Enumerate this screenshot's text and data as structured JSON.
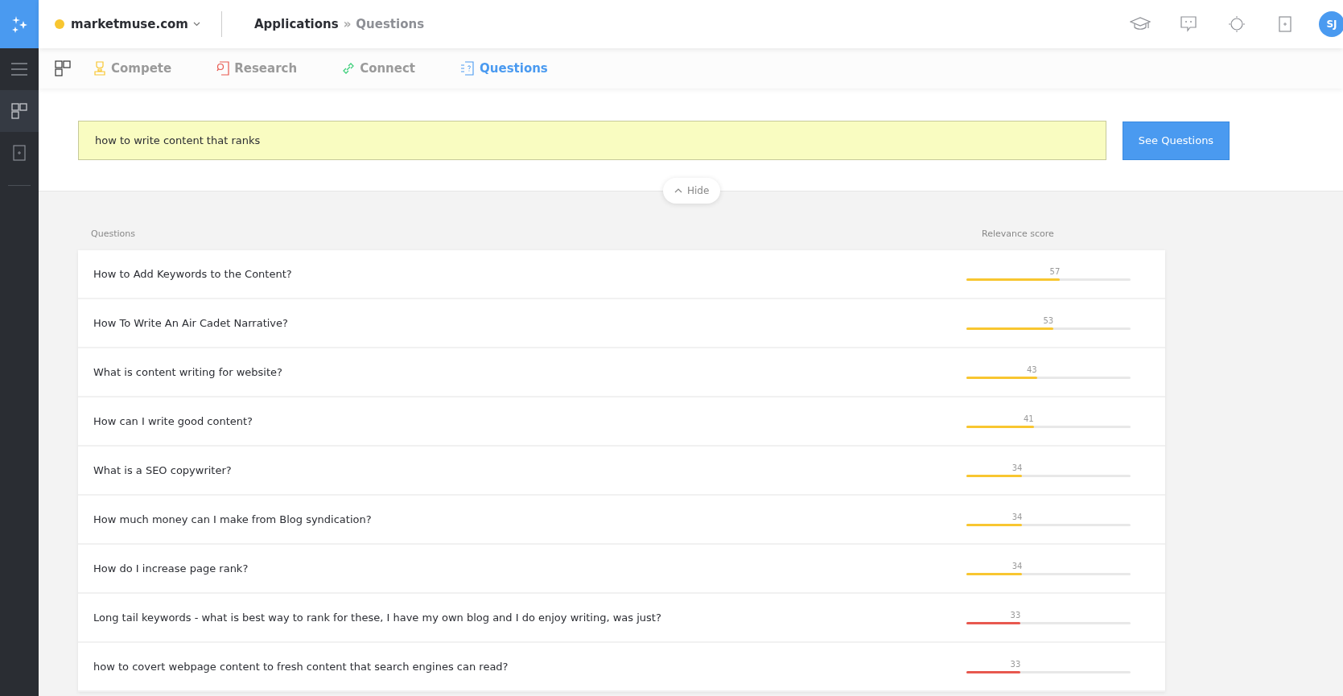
{
  "header": {
    "site": {
      "name": "marketmuse.com",
      "color": "#f8c630"
    },
    "breadcrumb": [
      "Applications",
      "Questions"
    ],
    "separator": "»",
    "avatar": "SJ"
  },
  "sidebar": {
    "items": [
      {
        "kind": "menu",
        "selected": false
      },
      {
        "kind": "apps",
        "selected": true
      },
      {
        "kind": "add",
        "selected": false
      }
    ]
  },
  "tabs": [
    {
      "label": "Compete",
      "kind": "compete",
      "selected": false
    },
    {
      "label": "Research",
      "kind": "research",
      "selected": false
    },
    {
      "label": "Connect",
      "kind": "connect",
      "selected": false
    },
    {
      "label": "Questions",
      "kind": "questions",
      "selected": true
    }
  ],
  "search": {
    "value": "how to write content that ranks",
    "button": "See Questions",
    "toggle": "Hide"
  },
  "table": {
    "columns": [
      "Questions",
      "Relevance score"
    ],
    "rows": [
      {
        "question": "How to Add Keywords to the Content?",
        "score": "57",
        "level": 0.57,
        "color": "#f8c630"
      },
      {
        "question": "How To Write An Air Cadet Narrative?",
        "score": "53",
        "level": 0.53,
        "color": "#f8c630"
      },
      {
        "question": "What is content writing for website?",
        "score": "43",
        "level": 0.43,
        "color": "#f8c630"
      },
      {
        "question": "How can I write good content?",
        "score": "41",
        "level": 0.41,
        "color": "#f8c630"
      },
      {
        "question": "What is a SEO copywriter?",
        "score": "34",
        "level": 0.34,
        "color": "#f8c630"
      },
      {
        "question": "How much money can I make from Blog syndication?",
        "score": "34",
        "level": 0.34,
        "color": "#f8c630"
      },
      {
        "question": "How do I increase page rank?",
        "score": "34",
        "level": 0.34,
        "color": "#f8c630"
      },
      {
        "question": "Long tail keywords - what is best way to rank for these, I have my own blog and I do enjoy writing, was just?",
        "score": "33",
        "level": 0.33,
        "color": "#e8584f"
      },
      {
        "question": "how to covert webpage content to fresh content that search engines can read?",
        "score": "33",
        "level": 0.33,
        "color": "#e8584f"
      }
    ]
  }
}
